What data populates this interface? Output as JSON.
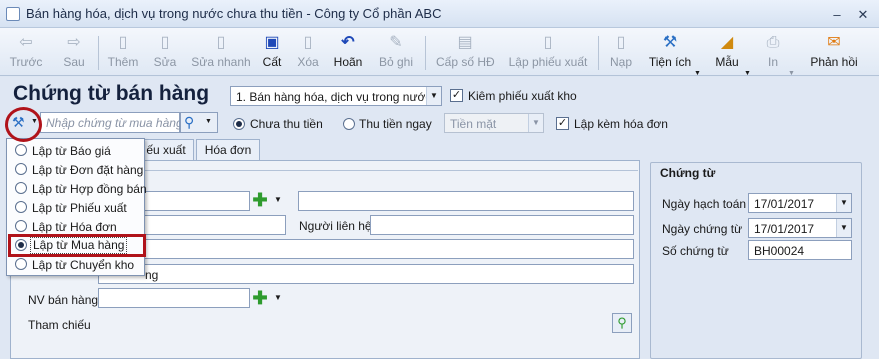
{
  "window": {
    "title": "Bán hàng hóa, dịch vụ trong nước chưa thu tiền - Công ty Cổ phần ABC",
    "controls": {
      "minimize": "–",
      "close": "✕"
    }
  },
  "toolbar": {
    "items": [
      {
        "label": "Trước",
        "icon": "arrow-left-icon",
        "glyph": "⇦",
        "enabled": false
      },
      {
        "label": "Sau",
        "icon": "arrow-right-icon",
        "glyph": "⇨",
        "enabled": false
      },
      {
        "label": "Thêm",
        "icon": "new-doc-icon",
        "glyph": "▯",
        "enabled": false
      },
      {
        "label": "Sửa",
        "icon": "edit-icon",
        "glyph": "▯",
        "enabled": false
      },
      {
        "label": "Sửa nhanh",
        "icon": "quick-edit-icon",
        "glyph": "▯",
        "enabled": false
      },
      {
        "label": "Cất",
        "icon": "save-icon",
        "glyph": "💾",
        "enabled": true
      },
      {
        "label": "Xóa",
        "icon": "delete-icon",
        "glyph": "▯",
        "enabled": false
      },
      {
        "label": "Hoãn",
        "icon": "undo-icon",
        "glyph": "↶",
        "enabled": true
      },
      {
        "label": "Bỏ ghi",
        "icon": "unpost-icon",
        "glyph": "✎",
        "enabled": false
      },
      {
        "label": "Cấp số HĐ",
        "icon": "invoice-number-icon",
        "glyph": "▤",
        "enabled": false
      },
      {
        "label": "Lập phiếu xuất",
        "icon": "issue-slip-icon",
        "glyph": "▯",
        "enabled": false
      },
      {
        "label": "Nạp",
        "icon": "reload-icon",
        "glyph": "▯",
        "enabled": false
      },
      {
        "label": "Tiện ích",
        "icon": "tools-icon",
        "glyph": "⚒",
        "enabled": true,
        "dropdown": true
      },
      {
        "label": "Mẫu",
        "icon": "template-icon",
        "glyph": "◢",
        "enabled": true,
        "dropdown": true
      },
      {
        "label": "In",
        "icon": "print-icon",
        "glyph": "⎙",
        "enabled": false,
        "dropdown": true
      },
      {
        "label": "Phản hồi",
        "icon": "feedback-icon",
        "glyph": "✉",
        "enabled": true
      }
    ]
  },
  "header": {
    "page_title": "Chứng từ bán hàng",
    "type_select": "1. Bán hàng hóa, dịch vụ trong nước",
    "chk_export_slip": {
      "label": "Kiêm phiếu xuất kho",
      "checked": true
    },
    "search_placeholder": "Nhập chứng từ mua hàng",
    "radio_unpaid": {
      "label": "Chưa thu tiền",
      "checked": true
    },
    "radio_paid": {
      "label": "Thu tiền ngay",
      "checked": false
    },
    "payment_method": "Tiền mặt",
    "chk_invoice": {
      "label": "Lập kèm hóa đơn",
      "checked": true
    }
  },
  "tabs": [
    {
      "label": "Phiếu xuất",
      "visible_fragment": "ếu xuất"
    },
    {
      "label": "Hóa đơn"
    }
  ],
  "form": {
    "contact_label": "Người liên hệ",
    "salesperson_label": "NV bán hàng",
    "reference_label": "Tham chiếu",
    "description_fragment": "ng"
  },
  "voucher": {
    "group_title": "Chứng từ",
    "posting_date_label": "Ngày hạch toán",
    "posting_date": "17/01/2017",
    "voucher_date_label": "Ngày chứng từ",
    "voucher_date": "17/01/2017",
    "voucher_no_label": "Số chứng từ",
    "voucher_no": "BH00024"
  },
  "menu": {
    "items": [
      {
        "label": "Lập từ Báo giá",
        "selected": false
      },
      {
        "label": "Lập từ Đơn đặt hàng",
        "selected": false
      },
      {
        "label": "Lập từ Hợp đồng bán",
        "selected": false
      },
      {
        "label": "Lập từ Phiếu xuất",
        "selected": false
      },
      {
        "label": "Lập từ Hóa đơn",
        "selected": false
      },
      {
        "label": "Lập từ Mua hàng",
        "selected": true
      },
      {
        "label": "Lập từ Chuyển kho",
        "selected": false
      }
    ]
  },
  "colors": {
    "highlight": "#b0131a",
    "accent": "#2e9b2e"
  }
}
